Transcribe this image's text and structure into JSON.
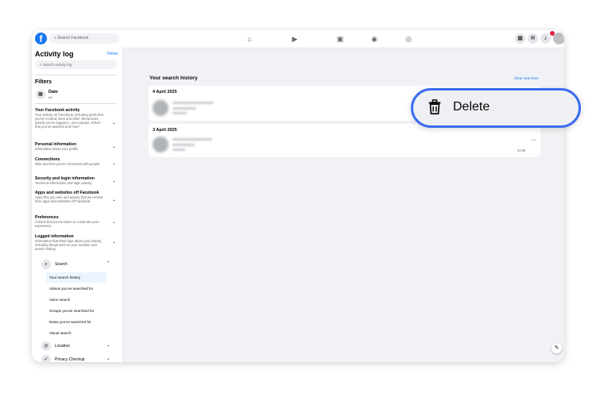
{
  "topbar": {
    "search_placeholder": "Search Facebook",
    "nav_icons": [
      "home-icon",
      "video-icon",
      "marketplace-icon",
      "groups-icon",
      "gaming-icon"
    ],
    "right_icons": [
      "menu-grid-icon",
      "messenger-icon",
      "notifications-icon"
    ]
  },
  "sidebar": {
    "title": "Activity log",
    "home_link": "Home",
    "search_placeholder": "Search activity log",
    "filters_heading": "Filters",
    "date": {
      "label": "Date",
      "value": "All"
    },
    "categories": [
      {
        "title": "Your Facebook activity",
        "desc": "Your activity on Facebook, including posts that you've created, likes and other interactions, activity you're tagged in, your groups, videos that you've watched and more"
      },
      {
        "title": "Personal information",
        "desc": "Information about your profile"
      },
      {
        "title": "Connections",
        "desc": "Who and how you've connected with people"
      },
      {
        "title": "Security and login information",
        "desc": "Technical information and login activity"
      },
      {
        "title": "Apps and websites off Facebook",
        "desc": "Apps that you own and activity that we receive from apps and websites off Facebook"
      },
      {
        "title": "Preferences",
        "desc": "Actions that you've taken to customise your experience"
      },
      {
        "title": "Logged information",
        "desc": "Information that Meta logs about your activity, including things such as your location and search history"
      }
    ],
    "search_group": {
      "label": "Search",
      "items": [
        "Your search history",
        "Videos you've searched for",
        "Voice search",
        "Groups you've searched for",
        "News you've searched for",
        "Visual search"
      ]
    },
    "location_label": "Location",
    "privacy_label": "Privacy Checkup"
  },
  "main": {
    "title": "Your search history",
    "clear_link": "Clear searches",
    "cards": [
      {
        "date": "4 April 2025"
      },
      {
        "date": "3 April 2025",
        "time": "22:08"
      }
    ]
  },
  "callout": {
    "label": "Delete",
    "icon": "trash-icon"
  }
}
